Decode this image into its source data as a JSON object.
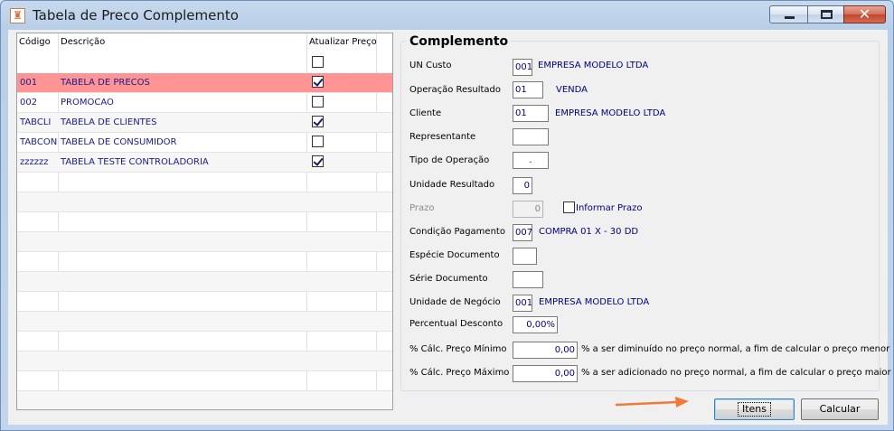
{
  "window": {
    "title": "Tabela de Preco Complemento",
    "close_glyph": "✕"
  },
  "grid": {
    "columns": [
      "Código",
      "Descrição",
      "Atualizar Preço"
    ],
    "header_checkbox": false,
    "rows": [
      {
        "codigo": "001",
        "descricao": "TABELA DE PRECOS",
        "atualizar": true,
        "selected": true
      },
      {
        "codigo": "002",
        "descricao": "PROMOCAO",
        "atualizar": false,
        "selected": false
      },
      {
        "codigo": "TABCLI",
        "descricao": "TABELA DE CLIENTES",
        "atualizar": true,
        "selected": false
      },
      {
        "codigo": "TABCON",
        "descricao": "TABELA DE CONSUMIDOR",
        "atualizar": false,
        "selected": false
      },
      {
        "codigo": "zzzzzz",
        "descricao": "TABELA TESTE CONTROLADORIA",
        "atualizar": true,
        "selected": false
      }
    ]
  },
  "complemento": {
    "title": "Complemento",
    "un_custo": {
      "label": "UN Custo",
      "value": "001",
      "desc": "EMPRESA MODELO LTDA"
    },
    "operacao_resultado": {
      "label": "Operação Resultado",
      "value": "01",
      "desc": "VENDA"
    },
    "cliente": {
      "label": "Cliente",
      "value": "01",
      "desc": "EMPRESA MODELO LTDA"
    },
    "representante": {
      "label": "Representante",
      "value": ""
    },
    "tipo_operacao": {
      "label": "Tipo de Operação",
      "value": "."
    },
    "unidade_resultado": {
      "label": "Unidade Resultado",
      "value": "0"
    },
    "prazo": {
      "label": "Prazo",
      "value": "0",
      "informar_label": "Informar Prazo",
      "informar_checked": false
    },
    "condicao_pagamento": {
      "label": "Condição Pagamento",
      "value": "007",
      "desc": "COMPRA 01 X - 30 DD"
    },
    "especie_documento": {
      "label": "Espécie Documento",
      "value": ""
    },
    "serie_documento": {
      "label": "Série Documento",
      "value": ""
    },
    "unidade_negocio": {
      "label": "Unidade de Negócio",
      "value": "001",
      "desc": "EMPRESA MODELO LTDA"
    },
    "percentual_desconto": {
      "label": "Percentual Desconto",
      "value": "0,00%"
    },
    "calc_preco_minimo": {
      "label": "% Cálc. Preço Mínimo",
      "value": "0,00",
      "note": "% a ser diminuído no preço normal, a fim de calcular o preço menor"
    },
    "calc_preco_maximo": {
      "label": "% Cálc. Preço Máximo",
      "value": "0,00",
      "note": "% a ser adicionado no preço normal, a fim de calcular o preço maior"
    }
  },
  "buttons": {
    "itens": "Itens",
    "calcular": "Calcular"
  },
  "colors": {
    "selected_row": "#ff9494",
    "arrow": "#f07a3a",
    "value_text": "#00007f"
  }
}
